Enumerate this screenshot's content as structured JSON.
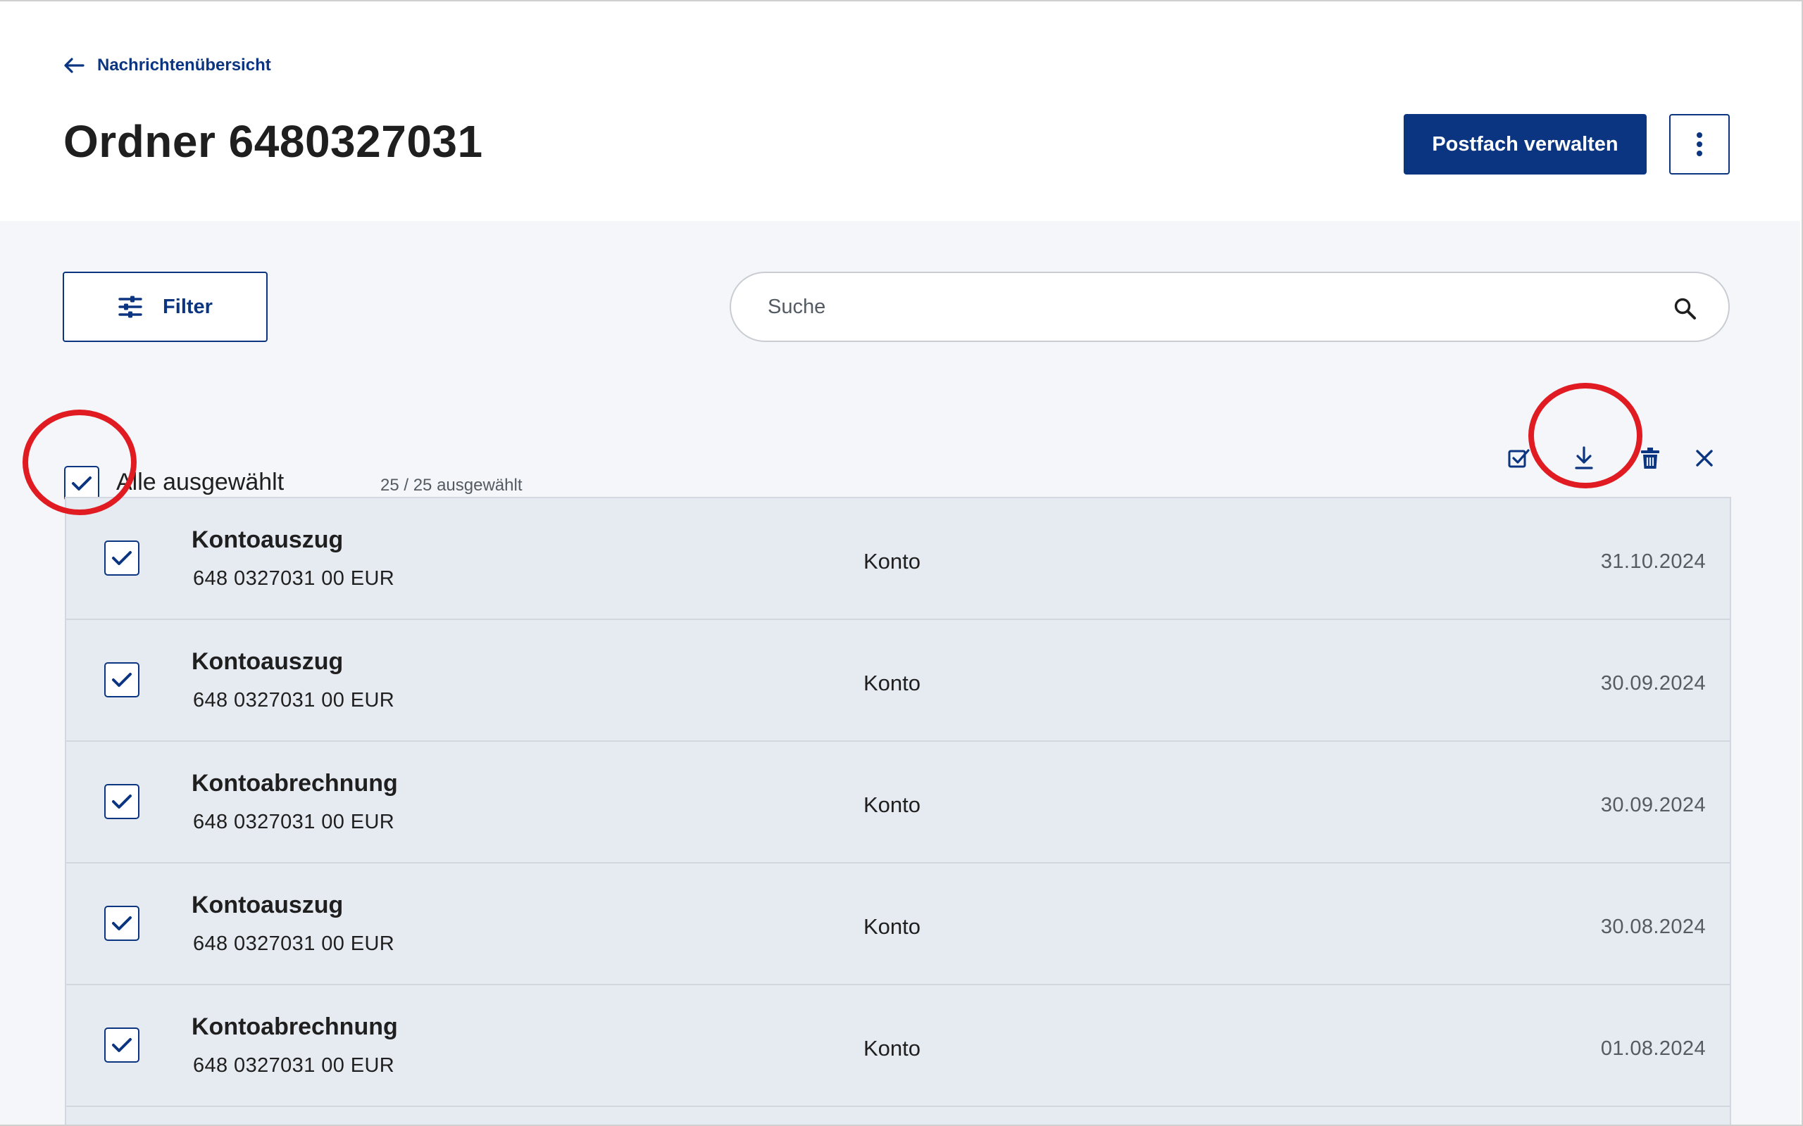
{
  "header": {
    "back_link": "Nachrichtenübersicht",
    "title": "Ordner 6480327031",
    "primary_button": "Postfach verwalten"
  },
  "toolbar": {
    "filter_label": "Filter",
    "search_placeholder": "Suche"
  },
  "selection": {
    "select_all_label": "Alle ausgewählt",
    "count_label": "25 / 25 ausgewählt"
  },
  "documents": [
    {
      "title": "Kontoauszug",
      "account": "648 0327031 00 EUR",
      "category": "Konto",
      "date": "31.10.2024",
      "checked": true
    },
    {
      "title": "Kontoauszug",
      "account": "648 0327031 00 EUR",
      "category": "Konto",
      "date": "30.09.2024",
      "checked": true
    },
    {
      "title": "Kontoabrechnung",
      "account": "648 0327031 00 EUR",
      "category": "Konto",
      "date": "30.09.2024",
      "checked": true
    },
    {
      "title": "Kontoauszug",
      "account": "648 0327031 00 EUR",
      "category": "Konto",
      "date": "30.08.2024",
      "checked": true
    },
    {
      "title": "Kontoabrechnung",
      "account": "648 0327031 00 EUR",
      "category": "Konto",
      "date": "01.08.2024",
      "checked": true
    }
  ],
  "colors": {
    "brand": "#0b3580",
    "annotation": "#e11b22",
    "list_background": "#e6eaf1",
    "content_background": "#f4f6f9"
  },
  "icons": [
    "back-arrow-icon",
    "more-vertical-icon",
    "filter-sliders-icon",
    "search-icon",
    "mark-read-icon",
    "download-icon",
    "trash-icon",
    "close-icon",
    "checkmark-icon"
  ]
}
